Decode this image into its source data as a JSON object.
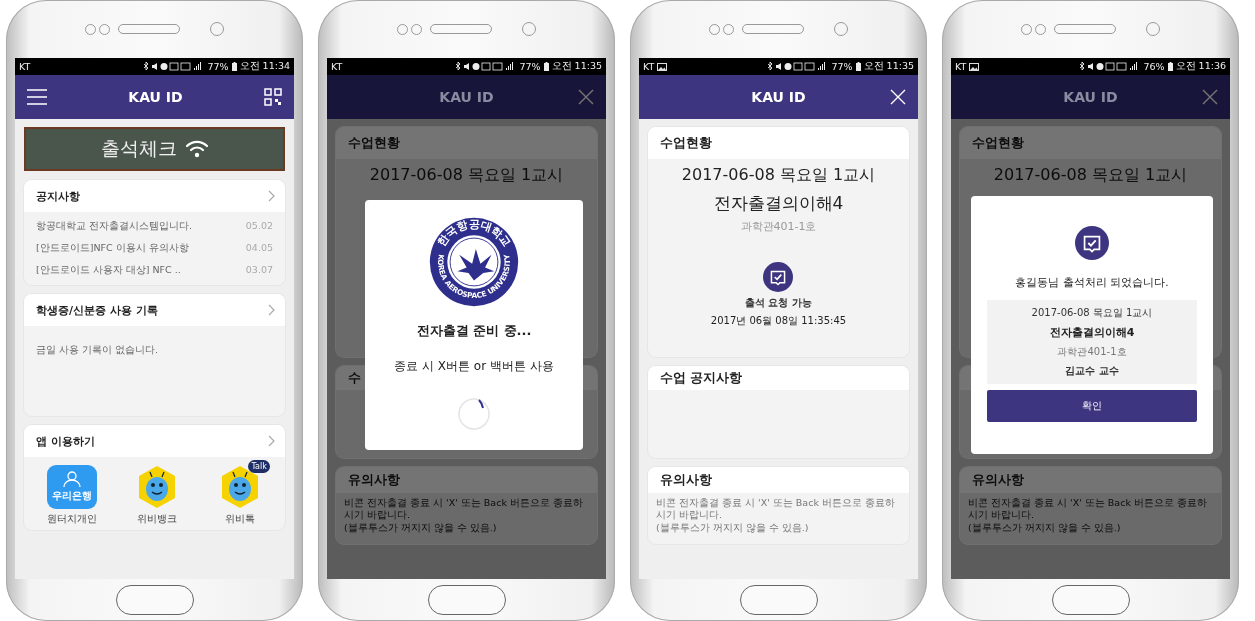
{
  "phones": [
    {
      "kind": "home",
      "status_bar": {
        "carrier": "KT",
        "photo_notification": false,
        "battery": "77%",
        "time": "오전 11:34"
      },
      "app_bar": {
        "title": "KAU ID"
      },
      "banner": {
        "text": "출석체크"
      },
      "notices": {
        "title": "공지사항",
        "items": [
          {
            "text": "항공대학교 전자출결시스템입니다.",
            "date": "05.02"
          },
          {
            "text": "[안드로이드]NFC 이용시 유의사항",
            "date": "04.05"
          },
          {
            "text": "[안드로이드 사용자 대상] NFC ..",
            "date": "03.07"
          }
        ]
      },
      "records": {
        "title": "학생증/신분증 사용 기록",
        "text": "금일 사용 기록이 없습니다."
      },
      "apps": {
        "title": "앱 이용하기",
        "items": [
          {
            "kind": "bank",
            "label": "원터치개인",
            "badge": "우리은행"
          },
          {
            "kind": "bee",
            "label": "위비뱅크"
          },
          {
            "kind": "bee",
            "label": "위비톡",
            "badge": "Talk"
          }
        ]
      }
    },
    {
      "kind": "class",
      "status_bar": {
        "carrier": "KT",
        "photo_notification": false,
        "battery": "77%",
        "time": "오전 11:35"
      },
      "app_bar": {
        "title": "KAU ID"
      },
      "lesson": {
        "title": "수업현황",
        "date": "2017-06-08 목요일 1교시"
      },
      "notice": {
        "title": "수"
      },
      "caution": {
        "title": "유의사항",
        "lines": [
          "비콘 전자출결 종료 시 'X' 또는 Back 버튼으로 종료하시기 바랍니다.",
          "(블루투스가 꺼지지 않을 수 있음.)"
        ]
      },
      "modal": {
        "kind": "loading",
        "seal": {
          "top": "한국항공대학교",
          "bottom": "KOREA AEROSPACE UNIVERSITY"
        },
        "title": "전자출결 준비 중...",
        "message": "종료 시 X버튼 or 백버튼 사용"
      }
    },
    {
      "kind": "class",
      "status_bar": {
        "carrier": "KT",
        "photo_notification": true,
        "battery": "77%",
        "time": "오전 11:35"
      },
      "app_bar": {
        "title": "KAU ID"
      },
      "lesson": {
        "title": "수업현황",
        "date": "2017-06-08 목요일 1교시",
        "course": "전자출결의이해4",
        "room": "과학관401-1호",
        "attendance": {
          "status": "출석 요청 가능",
          "time": "2017년 06월 08일 11:35:45"
        }
      },
      "notice": {
        "title": "수업 공지사항"
      },
      "caution": {
        "title": "유의사항",
        "lines": [
          "비콘 전자출결 종료 시 'X' 또는 Back 버튼으로 종료하시기 바랍니다.",
          "(블루투스가 꺼지지 않을 수 있음.)"
        ]
      }
    },
    {
      "kind": "class",
      "status_bar": {
        "carrier": "KT",
        "photo_notification": true,
        "battery": "76%",
        "time": "오전 11:36"
      },
      "app_bar": {
        "title": "KAU ID"
      },
      "lesson": {
        "title": "수업현황",
        "date": "2017-06-08 목요일 1교시"
      },
      "caution": {
        "title": "유의사항",
        "lines": [
          "비콘 전자출결 종료 시 'X' 또는 Back 버튼으로 종료하시기 바랍니다.",
          "(블루투스가 꺼지지 않을 수 있음.)"
        ]
      },
      "modal": {
        "kind": "done",
        "message": "홍길동님 출석처리 되었습니다.",
        "details": {
          "date": "2017-06-08 목요일 1교시",
          "course": "전자출결의이해4",
          "room": "과학관401-1호",
          "professor": "김교수 교수"
        },
        "button": "확인"
      }
    }
  ]
}
